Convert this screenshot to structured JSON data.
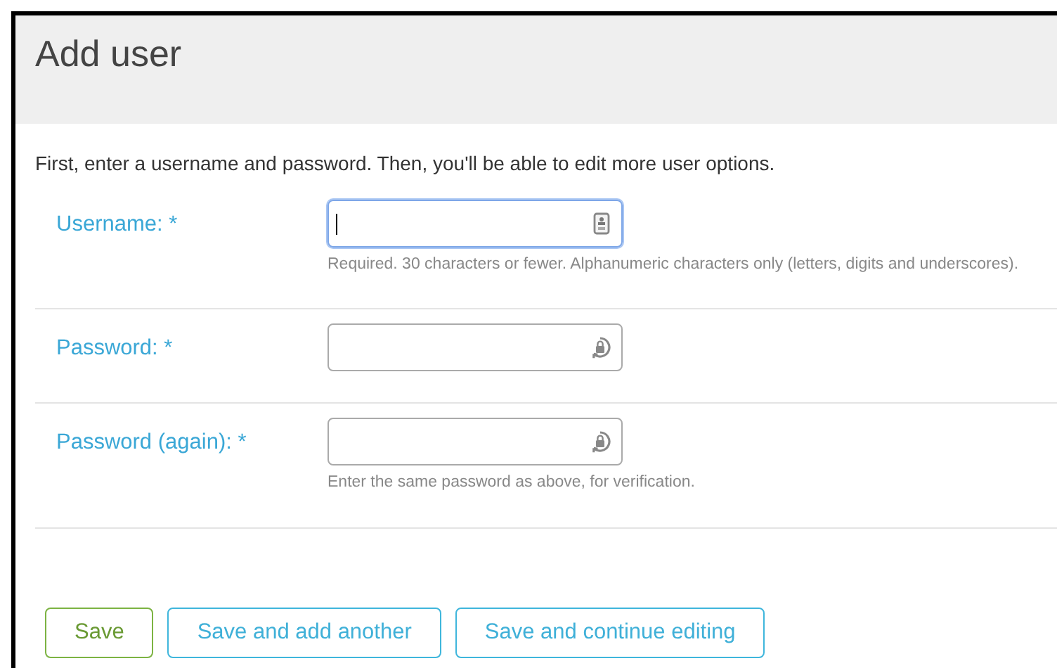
{
  "title": "Add user",
  "intro": "First, enter a username and password. Then, you'll be able to edit more user options.",
  "fields": [
    {
      "label": "Username: *",
      "focused": true,
      "kind": "username",
      "help": "Required. 30 characters or fewer. Alphanumeric characters only (letters, digits and underscores)."
    },
    {
      "label": "Password: *",
      "focused": false,
      "kind": "password"
    },
    {
      "label": "Password (again): *",
      "focused": false,
      "kind": "password",
      "help": "Enter the same password as above, for verification."
    }
  ],
  "buttons": [
    {
      "label": "Save",
      "kind": "primary"
    },
    {
      "label": "Save and add another",
      "kind": "secondary"
    },
    {
      "label": "Save and continue editing",
      "kind": "secondary"
    }
  ]
}
